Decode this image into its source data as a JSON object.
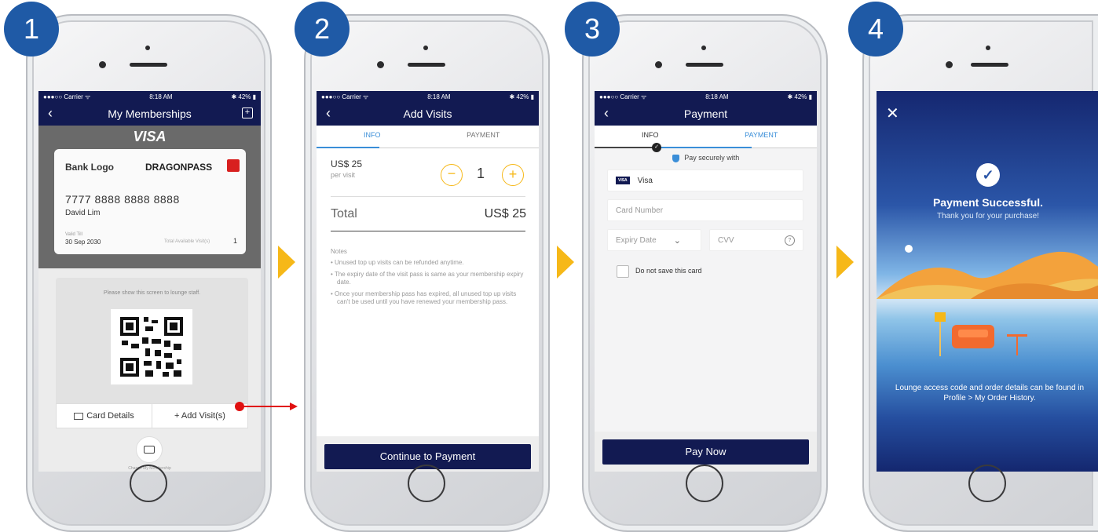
{
  "steps": [
    "1",
    "2",
    "3",
    "4"
  ],
  "status": {
    "carrier": "●●●○○ Carrier ᯤ",
    "time": "8:18 AM",
    "battery": "✱ 42% ▮"
  },
  "s1": {
    "title": "My Memberships",
    "brand": "VISA",
    "bank_logo": "Bank Logo",
    "partner": "DRAGONPASS",
    "card_number": "7777 8888 8888 8888",
    "holder": "David Lim",
    "valid_label": "Valid Till",
    "valid_date": "30 Sep 2030",
    "visits_label": "Total Available Visit(s)",
    "visits_value": "1",
    "qr_note": "Please show this screen to lounge staff.",
    "card_details": "Card Details",
    "add_visits": "+ Add Visit(s)",
    "change_membership": "Change My Membership"
  },
  "s2": {
    "title": "Add Visits",
    "tab_info": "INFO",
    "tab_payment": "PAYMENT",
    "price": "US$ 25",
    "per_visit": "per visit",
    "qty": "1",
    "total_label": "Total",
    "total_value": "US$ 25",
    "notes_title": "Notes",
    "notes": [
      "Unused top up visits can be refunded anytime.",
      "The expiry date of the visit pass is same as your membership expiry date.",
      "Once your membership pass has expired, all unused top up visits can't be used until you have renewed your membership pass."
    ],
    "continue": "Continue to Payment"
  },
  "s3": {
    "title": "Payment",
    "tab_info": "INFO",
    "tab_payment": "PAYMENT",
    "secure": "Pay securely with",
    "visa_chip": "VISA",
    "visa": "Visa",
    "card_number_ph": "Card Number",
    "expiry_ph": "Expiry Date",
    "cvv_ph": "CVV",
    "dont_save": "Do not save this card",
    "pay_now": "Pay Now"
  },
  "s4": {
    "heading": "Payment Successful.",
    "sub": "Thank you for your purchase!",
    "footer": "Lounge access code and order details can be found in Profile > My Order History."
  },
  "colors": {
    "navy": "#121a52",
    "badge": "#1f5aa6",
    "arrow": "#f6b818",
    "accent": "#3a8ed8",
    "step_btn": "#f6b818",
    "red": "#e01010"
  }
}
